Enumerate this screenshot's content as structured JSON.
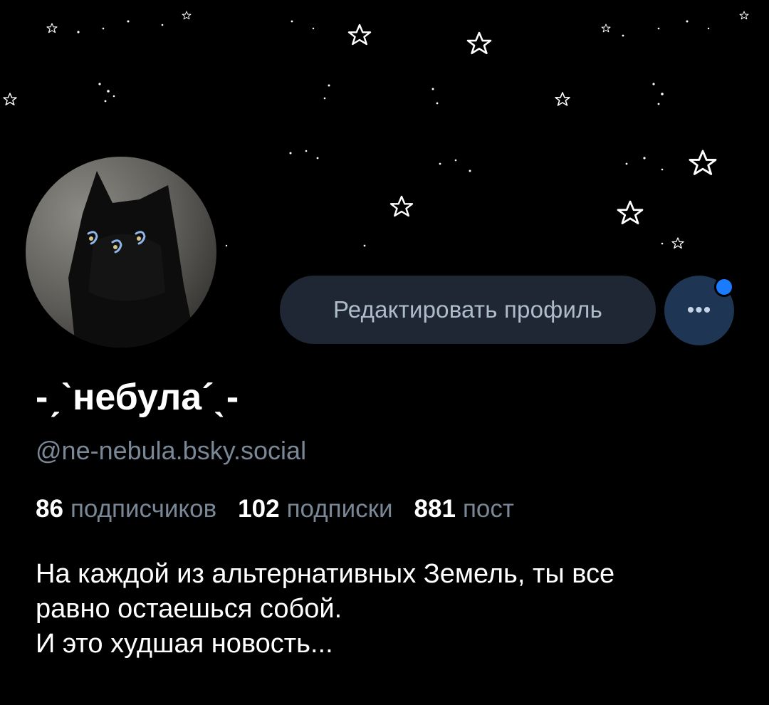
{
  "colors": {
    "background": "#000000",
    "button_bg": "#1e2733",
    "button_text": "#aebbc9",
    "more_button_bg": "#1e3554",
    "notification_dot": "#1b7bff",
    "muted_text": "#7a8796"
  },
  "banner": {
    "icon": "stars-banner-image"
  },
  "avatar": {
    "icon": "black-cat-avatar"
  },
  "profile": {
    "edit_button_label": "Редактировать профиль",
    "more_button_label": "•••",
    "display_name": "-ˏˋнебула´ˎ-",
    "handle": "@ne-nebula.bsky.social"
  },
  "stats": {
    "followers": {
      "count": "86",
      "label": "подписчиков"
    },
    "following": {
      "count": "102",
      "label": "подписки"
    },
    "posts": {
      "count": "881",
      "label": "пост"
    }
  },
  "bio": {
    "line1": "На каждой из альтернативных Земель, ты все",
    "line2": "равно остаешься собой.",
    "line3": "И это худшая новость..."
  }
}
